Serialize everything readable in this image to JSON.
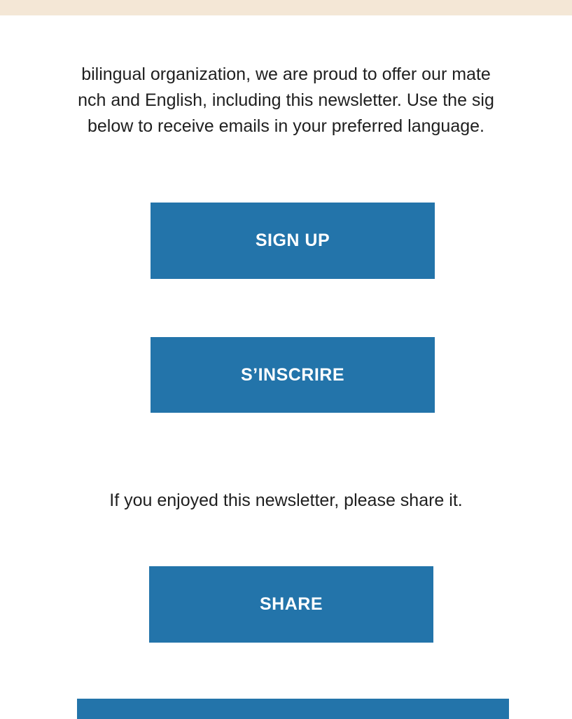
{
  "intro": {
    "line1": "bilingual organization, we are proud to offer our mate",
    "line2": "nch and English, including this newsletter. Use the sig",
    "line3": "below to receive emails in your preferred language."
  },
  "buttons": {
    "signup_label": "SIGN UP",
    "inscrire_label": "S’INSCRIRE",
    "share_label": "SHARE"
  },
  "share_prompt": "If you enjoyed this newsletter, please share it.",
  "colors": {
    "top_band": "#f4e7d6",
    "button_bg": "#2374aa",
    "button_text": "#ffffff"
  }
}
